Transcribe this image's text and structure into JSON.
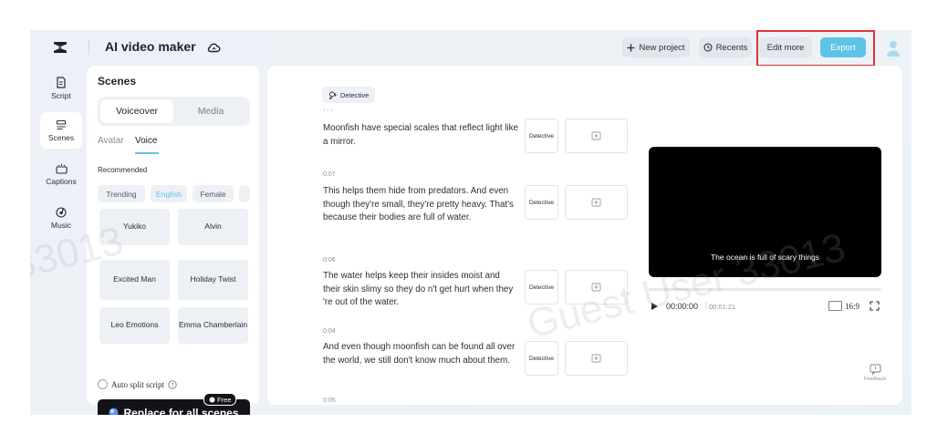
{
  "header": {
    "app_title": "AI video maker",
    "new_project_label": "New project",
    "recents_label": "Recents",
    "edit_more_label": "Edit more",
    "export_label": "Export"
  },
  "rail": {
    "items": [
      {
        "label": "Script",
        "icon": "script-icon"
      },
      {
        "label": "Scenes",
        "icon": "scenes-icon",
        "active": true
      },
      {
        "label": "Captions",
        "icon": "captions-icon"
      },
      {
        "label": "Music",
        "icon": "music-icon"
      }
    ]
  },
  "scenes_panel": {
    "title": "Scenes",
    "segments": [
      "Voiceover",
      "Media"
    ],
    "subtabs": [
      "Avatar",
      "Voice"
    ],
    "section_label": "Recommended",
    "chips": [
      "Trending",
      "English",
      "Female"
    ],
    "voices": [
      "Yukiko",
      "Alvin",
      "Excited Man",
      "Holiday Twist",
      "Leo Emotions",
      "Emma Chamberlain"
    ],
    "auto_split_label": "Auto split script",
    "replace_label": "Replace for all scenes",
    "free_badge": "Free"
  },
  "main": {
    "character_tag": "Detective",
    "scenes": [
      {
        "time": "",
        "text": "Moonfish have special scales that reflect light like a mirror.",
        "detective_label": "Detective"
      },
      {
        "time": "0:07",
        "text": "This helps them hide from predators. And even though they're small, they're pretty heavy. That's because their bodies are full of water.",
        "detective_label": "Detective"
      },
      {
        "time": "0:06",
        "text": "The water helps keep their insides moist and their skin slimy so they do n't get hurt when they 're out of the water.",
        "detective_label": "Detective"
      },
      {
        "time": "0:04",
        "text": "And even though moonfish can be found all over the world, we still don't know much about them.",
        "detective_label": "Detective"
      }
    ],
    "next_time": "0:05"
  },
  "player": {
    "subtitle": "The ocean is full of scary things",
    "current_time": "00:00:00",
    "duration": "00:01:21",
    "aspect_ratio": "16:9",
    "progress": 0
  },
  "feedback_label": "Feedback",
  "watermark": {
    "id": "33013",
    "text": "Guest User 33013"
  },
  "colors": {
    "accent": "#5ec3e6",
    "highlight_box": "#d93636",
    "dark_button": "#121417"
  }
}
